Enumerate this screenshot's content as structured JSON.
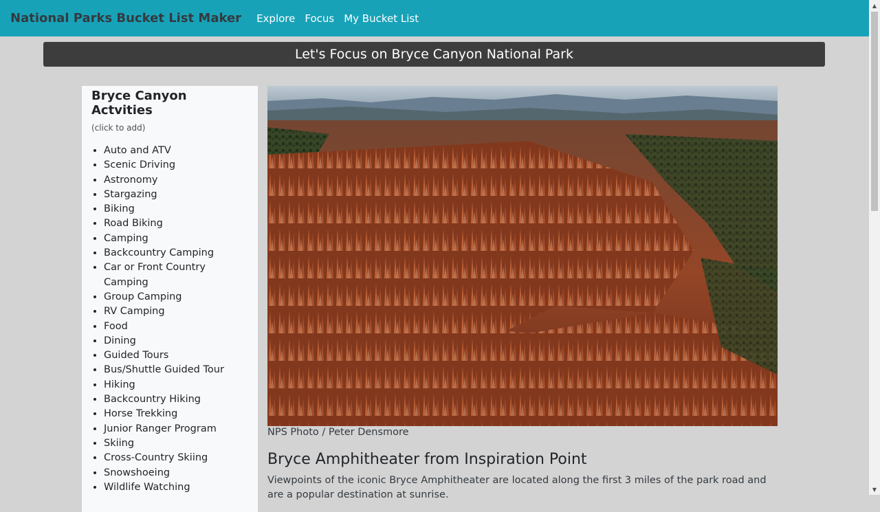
{
  "nav": {
    "brand": "National Parks Bucket List Maker",
    "links": [
      "Explore",
      "Focus",
      "My Bucket List"
    ]
  },
  "banner": {
    "text": "Let's Focus on Bryce Canyon National Park"
  },
  "sidebar": {
    "title": "Bryce Canyon Actvities",
    "hint": "(click to add)",
    "activities": [
      "Auto and ATV",
      "Scenic Driving",
      "Astronomy",
      "Stargazing",
      "Biking",
      "Road Biking",
      "Camping",
      "Backcountry Camping",
      "Car or Front Country Camping",
      "Group Camping",
      "RV Camping",
      "Food",
      "Dining",
      "Guided Tours",
      "Bus/Shuttle Guided Tour",
      "Hiking",
      "Backcountry Hiking",
      "Horse Trekking",
      "Junior Ranger Program",
      "Skiing",
      "Cross-Country Skiing",
      "Snowshoeing",
      "Wildlife Watching"
    ]
  },
  "main": {
    "photo_credit": "NPS Photo / Peter Densmore",
    "section_title": "Bryce Amphitheater from Inspiration Point",
    "section_body": "Viewpoints of the iconic Bryce Amphitheater are located along the first 3 miles of the park road and are a popular destination at sunrise."
  },
  "colors": {
    "nav_bg": "#17a2b8",
    "banner_bg": "#3d3d3d",
    "page_bg": "#d3d3d3",
    "sidebar_bg": "#f8f9fa"
  }
}
